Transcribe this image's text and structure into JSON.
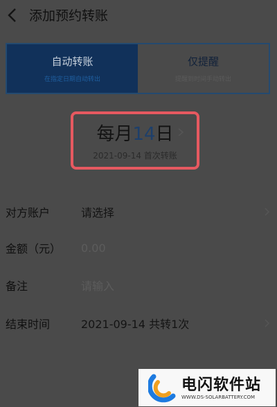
{
  "header": {
    "title": "添加预约转账"
  },
  "mode_selector": {
    "options": [
      {
        "title": "自动转账",
        "subtitle": "在指定日期自动转出",
        "active": true
      },
      {
        "title": "仅提醒",
        "subtitle": "提醒到时间手动转出",
        "active": false
      }
    ]
  },
  "schedule": {
    "prefix": "每月",
    "day": "14",
    "suffix": "日",
    "first_transfer": "2021-09-14 首次转账"
  },
  "form": {
    "rows": [
      {
        "label": "对方账户",
        "value": "请选择",
        "placeholder": false
      },
      {
        "label": "金额（元）",
        "value": "0.00",
        "placeholder": true
      },
      {
        "label": "备注",
        "value": "请输入",
        "placeholder": true
      },
      {
        "label": "结束时间",
        "value": "2021-09-14 共转1次",
        "placeholder": false
      }
    ]
  },
  "watermark": {
    "title": "电闪软件站",
    "url": "WWW.DS-SOLARBATTERY.COM"
  },
  "colors": {
    "overlay_bg": "#4a4a4a",
    "active_segment": "#11315a",
    "highlight_border": "#e65960",
    "accent_blue": "#1d3f6b"
  }
}
